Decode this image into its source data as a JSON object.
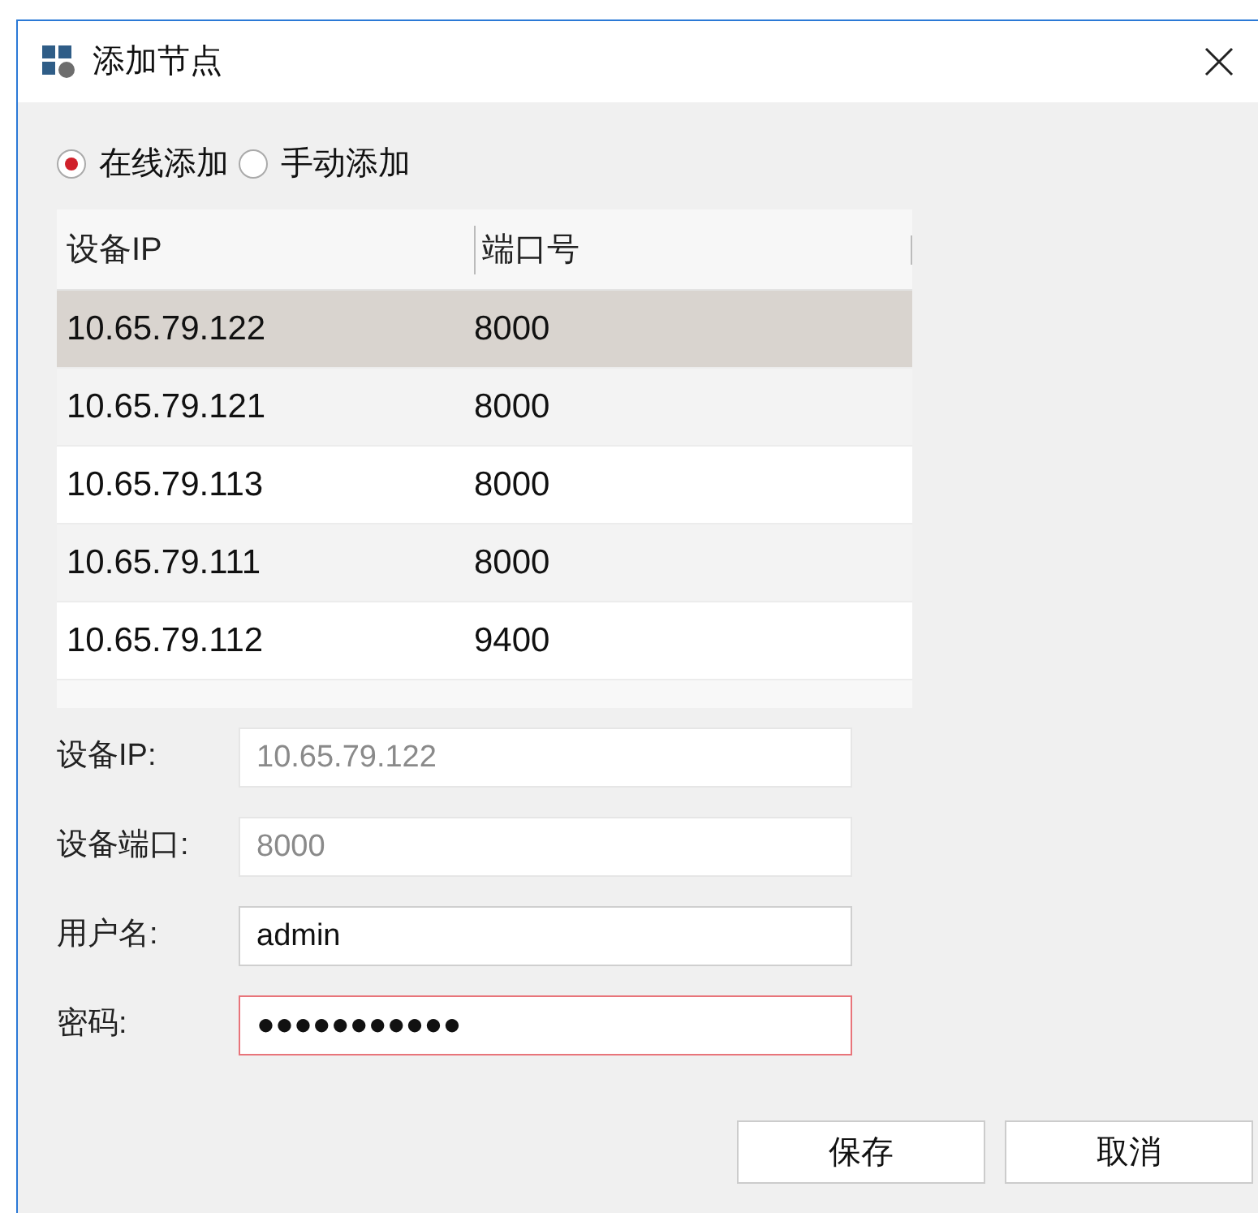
{
  "window": {
    "title": "添加节点"
  },
  "modes": [
    {
      "label": "在线添加",
      "selected": true
    },
    {
      "label": "手动添加",
      "selected": false
    }
  ],
  "table": {
    "columns": [
      "设备IP",
      "端口号"
    ],
    "rows": [
      {
        "cells": [
          "10.65.79.122",
          "8000"
        ],
        "selected": true
      },
      {
        "cells": [
          "10.65.79.121",
          "8000"
        ],
        "selected": false
      },
      {
        "cells": [
          "10.65.79.113",
          "8000"
        ],
        "selected": false
      },
      {
        "cells": [
          "10.65.79.111",
          "8000"
        ],
        "selected": false
      },
      {
        "cells": [
          "10.65.79.112",
          "9400"
        ],
        "selected": false
      }
    ]
  },
  "form": [
    {
      "label": "设备IP:",
      "value": "10.65.79.122",
      "disabled": true,
      "focused": false
    },
    {
      "label": "设备端口:",
      "value": "8000",
      "disabled": true,
      "focused": false
    },
    {
      "label": "用户名:",
      "value": "admin",
      "disabled": false,
      "focused": false
    },
    {
      "label": "密码:",
      "value": "●●●●●●●●●●●",
      "disabled": false,
      "focused": true
    }
  ],
  "buttons": [
    "保存",
    "取消"
  ]
}
